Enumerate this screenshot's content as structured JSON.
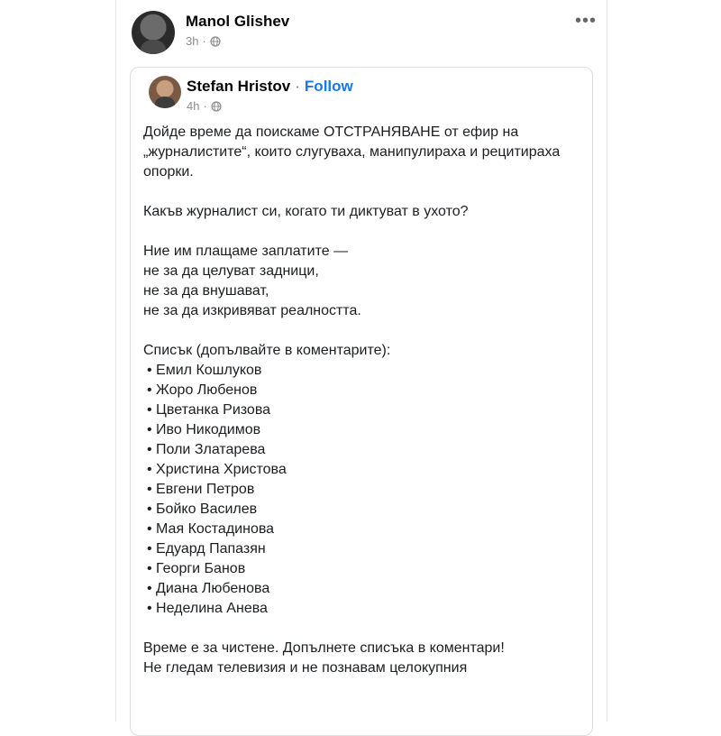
{
  "post": {
    "author": "Manol Glishev",
    "time": "3h",
    "sep": "·",
    "more_icon": "more-horizontal-icon",
    "privacy_icon": "globe-icon"
  },
  "shared": {
    "author": "Stefan Hristov",
    "sep": "·",
    "follow_label": "Follow",
    "time": "4h",
    "privacy_icon": "globe-icon",
    "paragraph1": "Дойде време да поискаме ОТСТРАНЯВАНЕ от ефир на „журналистите“, които слугуваха, манипулираха и рецитираха опорки.",
    "paragraph2": "Какъв журналист си, когато ти диктуват в ухото?",
    "paragraph3_lines": [
      "Ние им плащаме заплатите —",
      "не за да целуват задници,",
      "не за да внушават,",
      "не за да изкривяват реалността."
    ],
    "list_title": "Списък (допълвайте в коментарите):",
    "names": [
      "Емил Кошлуков",
      "Жоро Любенов",
      "Цветанка Ризова",
      "Иво Никодимов",
      "Поли Златарева",
      "Христина Христова",
      "Евгени Петров",
      "Бойко Василев",
      "Мая Костадинова",
      "Едуард Папазян",
      "Георги Банов",
      "Диана Любенова",
      "Неделина Анева"
    ],
    "closing1": "Време е за чистене. Допълнете списъка в коментари!",
    "closing2": "Не гледам телевизия и не познавам целокупния"
  }
}
